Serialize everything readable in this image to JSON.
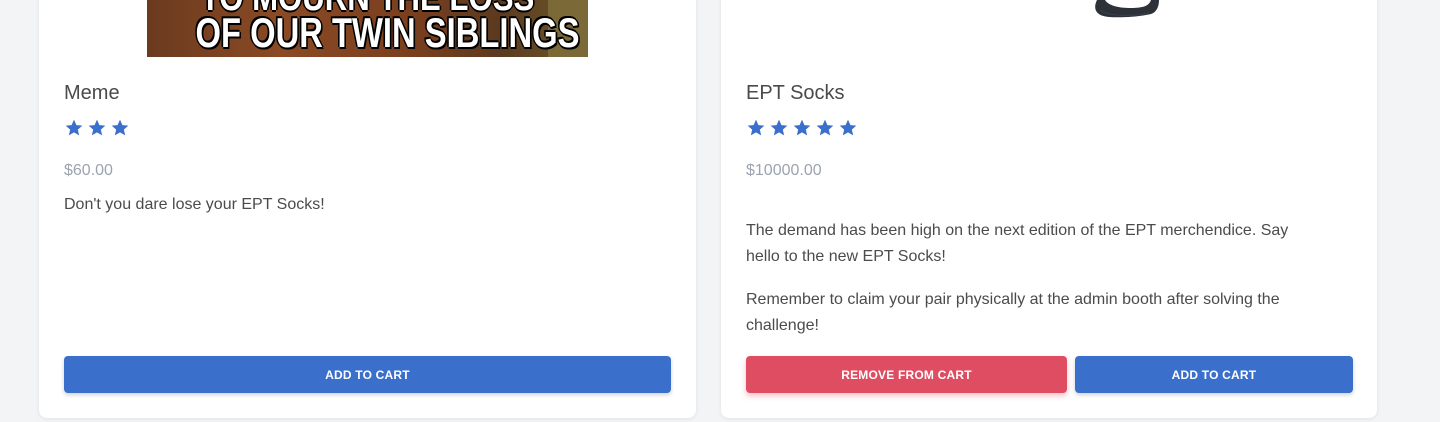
{
  "colors": {
    "accent": "#3a6fcc",
    "danger": "#df4d63",
    "star": "#3a6fcc",
    "price": "#9ca3af"
  },
  "products": [
    {
      "image_caption_partial": "TO MOURN THE LOSS",
      "image_caption": "OF OUR TWIN SIBLINGS",
      "title": "Meme",
      "rating": 3,
      "price": "$60.00",
      "description": [
        "Don't you dare lose your EPT Socks!"
      ],
      "add_label": "ADD TO CART"
    },
    {
      "image": "sock-image",
      "title": "EPT Socks",
      "rating": 5,
      "price": "$10000.00",
      "description": [
        "The demand has been high on the next edition of the EPT merchendice. Say hello to the new EPT Socks!",
        "Remember to claim your pair physically at the admin booth after solving the challenge!"
      ],
      "remove_label": "REMOVE FROM CART",
      "add_label": "ADD TO CART"
    }
  ]
}
